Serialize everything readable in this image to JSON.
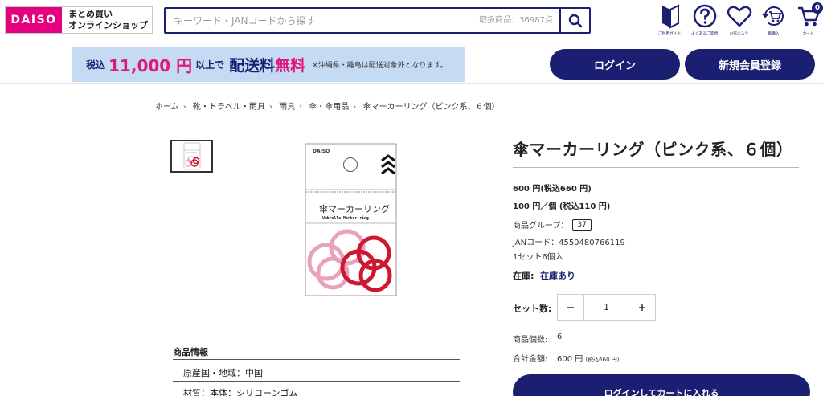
{
  "header": {
    "logo_text": "DAISO",
    "logo_sub1": "まとめ買い",
    "logo_sub2": "オンラインショップ",
    "search_placeholder": "キーワード・JANコードから探す",
    "search_count": "取扱商品：36987点",
    "icons": [
      {
        "label": "ご利用ガイド",
        "icon": "beginner-icon"
      },
      {
        "label": "よくあるご質問",
        "icon": "question-icon"
      },
      {
        "label": "お気に入り",
        "icon": "heart-icon"
      },
      {
        "label": "再購入",
        "icon": "repurchase-cart-icon"
      },
      {
        "label": "カート",
        "icon": "cart-icon"
      }
    ],
    "cart_count": "0",
    "login_label": "ログイン",
    "register_label": "新規会員登録"
  },
  "shipping_banner": {
    "part1": "税込",
    "part2": "11,000 円",
    "part3": "以上で",
    "part4": "配送料",
    "part5": "無料",
    "note": "※沖縄県・離島は配送対象外となります。"
  },
  "breadcrumb": [
    "ホーム",
    "靴・トラベル・雨具",
    "雨具",
    "傘・傘用品",
    "傘マーカーリング（ピンク系、６個）"
  ],
  "product": {
    "title": "傘マーカーリング（ピンク系、６個）",
    "price": "600 円(税込660 円)",
    "unit_price": "100 円／個 (税込110 円)",
    "group_label": "商品グループ：",
    "group_value": "37",
    "jan": "JANコード：4550480766119",
    "set_desc": "1セット6個入",
    "stock_label": "在庫:",
    "stock_value": "在庫あり",
    "set_qty_label": "セット数:",
    "quantity": "1",
    "item_count_label": "商品個数:",
    "item_count": "6",
    "total_label": "合計金額:",
    "total_value": "600 円",
    "total_tax": "(税込660 円)",
    "cart_button": "ログインしてカートに入れる",
    "package_name": "傘マーカーリング",
    "package_name_en": "Umbrella Marker ring",
    "package_brand": "DAISO"
  },
  "info": {
    "title": "商品情報",
    "rows": [
      "原産国・地域：中国",
      "材質：本体：シリコーンゴム"
    ]
  },
  "colors": {
    "navy": "#1a1f71",
    "magenta": "#e4007f",
    "banner_bg": "#c5daf3"
  }
}
